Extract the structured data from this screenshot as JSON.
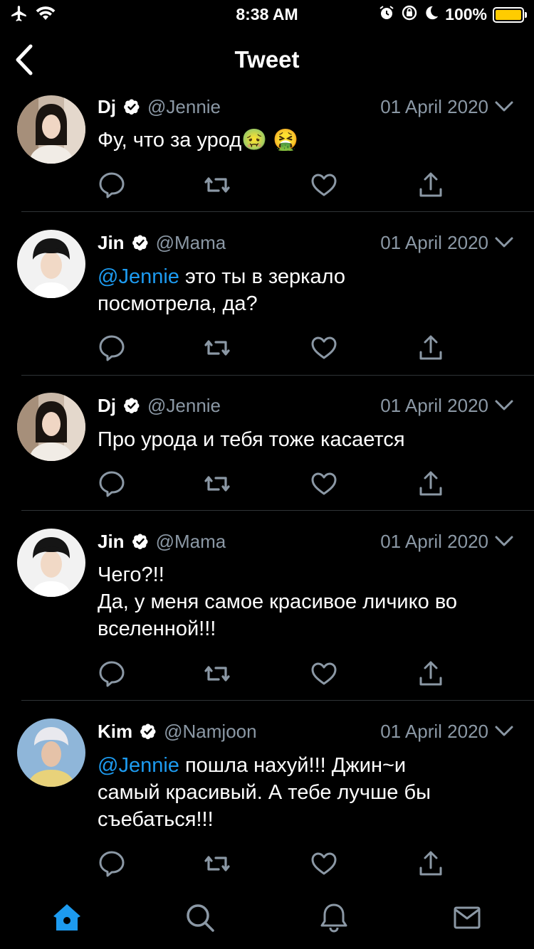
{
  "status_bar": {
    "time": "8:38 AM",
    "battery": "100%",
    "battery_level": 1.0,
    "icons": [
      "airplane-icon",
      "wifi-icon",
      "alarm-icon",
      "orientation-lock-icon",
      "moon-icon",
      "battery-icon"
    ]
  },
  "header": {
    "title": "Tweet"
  },
  "tweets": [
    {
      "name": "Dj",
      "handle": "@Jennie",
      "date": "01 April 2020",
      "mention": "",
      "text": "Фу, что за урод🤢 🤮"
    },
    {
      "name": "Jin",
      "handle": "@Mama",
      "date": "01 April 2020",
      "mention": "@Jennie",
      "text": " это ты в зеркало\nпосмотрела, да?"
    },
    {
      "name": "Dj",
      "handle": "@Jennie",
      "date": "01 April 2020",
      "mention": "",
      "text": "Про урода и тебя тоже касается"
    },
    {
      "name": "Jin",
      "handle": "@Mama",
      "date": "01 April 2020",
      "mention": "",
      "text": "Чего?!!\nДа, у меня самое красивое личико во\nвселенной!!!"
    },
    {
      "name": "Kim",
      "handle": "@Namjoon",
      "date": "01 April 2020",
      "mention": "@Jennie",
      "text": " пошла нахуй!!! Джин~и\nсамый красивый. А тебе лучше бы\nсъебаться!!!"
    }
  ],
  "tab_bar": {
    "items": [
      "home-icon",
      "search-icon",
      "notifications-icon",
      "messages-icon"
    ],
    "active": "home-icon",
    "accent": "#1d9bf0"
  },
  "colors": {
    "background": "#000000",
    "text": "#ffffff",
    "secondary_text": "#8b98a5",
    "mention": "#1d9bf0",
    "battery": "#ffcc00",
    "divider": "#2f3336"
  }
}
